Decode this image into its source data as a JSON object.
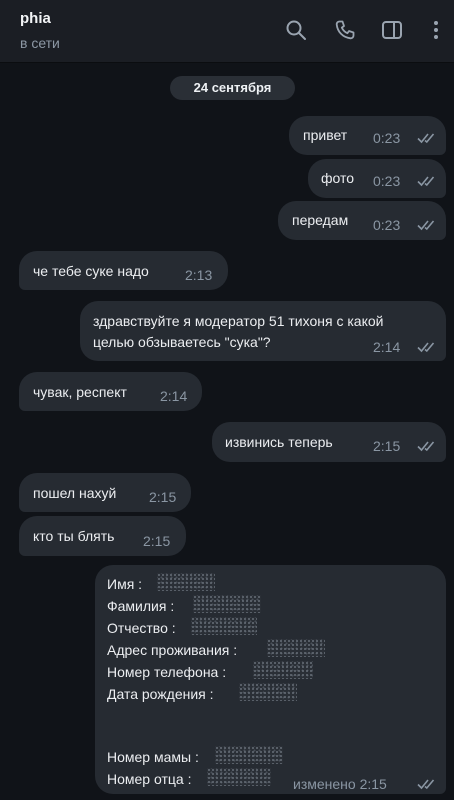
{
  "header": {
    "name": "phia",
    "status": "в сети",
    "icons": [
      "search-icon",
      "phone-icon",
      "sidebar-toggle-icon",
      "more-icon"
    ]
  },
  "date_separator": "24 сентября",
  "messages": [
    {
      "dir": "out",
      "text": "привет",
      "time": "0:23"
    },
    {
      "dir": "out",
      "text": "фото",
      "time": "0:23"
    },
    {
      "dir": "out",
      "text": "передам",
      "time": "0:23"
    },
    {
      "dir": "in",
      "text": "че тебе суке надо",
      "time": "2:13"
    },
    {
      "dir": "out",
      "lines": [
        "здравствуйте я модератор 51 тихоня с какой",
        "целью обзываетесь \"сука\"?"
      ],
      "time": "2:14"
    },
    {
      "dir": "in",
      "text": "чувак, респект",
      "time": "2:14"
    },
    {
      "dir": "out",
      "text": "извинись теперь",
      "time": "2:15"
    },
    {
      "dir": "in",
      "text": "пошел нахуй",
      "time": "2:15"
    },
    {
      "dir": "in",
      "text": "кто ты блять",
      "time": "2:15"
    },
    {
      "dir": "out",
      "form": [
        "Имя :",
        "Фамилия :",
        "Отчество :",
        "Адрес проживания :",
        "Номер телефона :",
        "Дата рождения :",
        "Номер мамы :",
        "Номер отца :"
      ],
      "edited_time": "изменено 2:15"
    }
  ]
}
